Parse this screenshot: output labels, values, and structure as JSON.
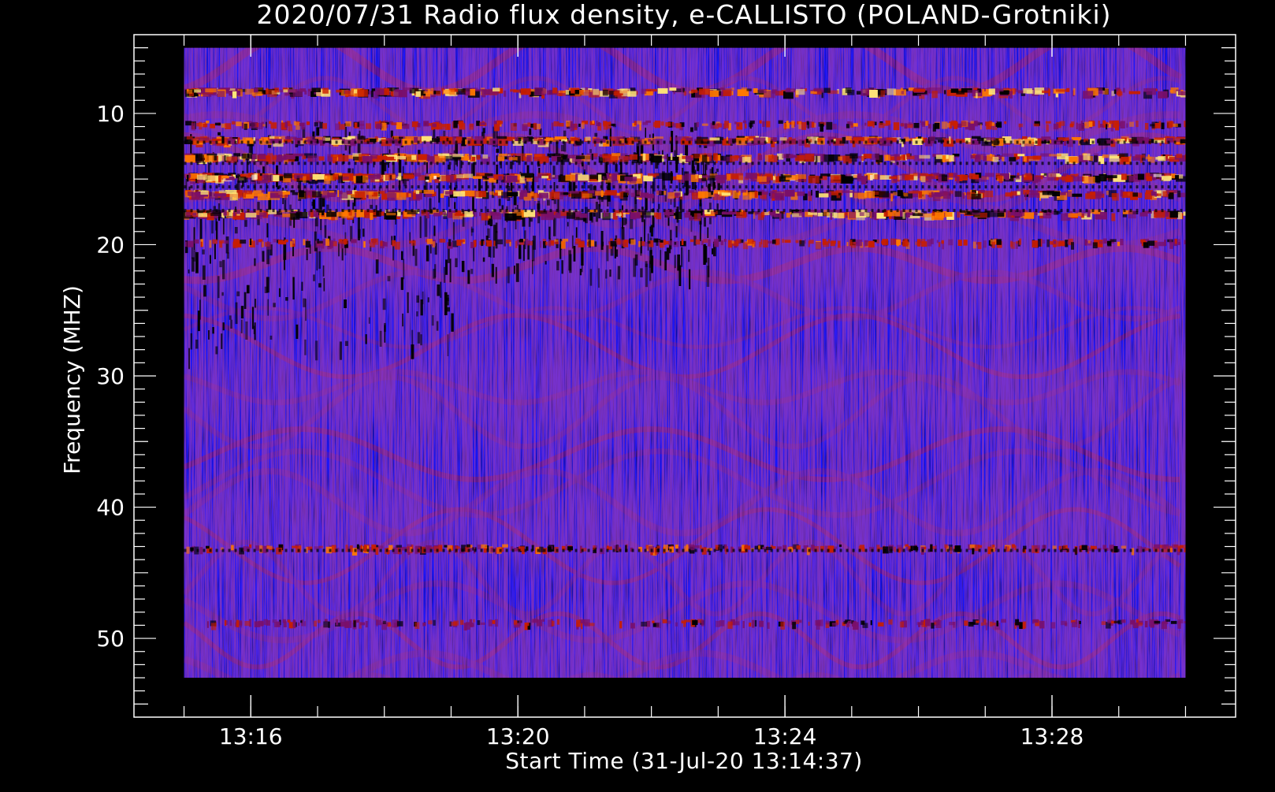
{
  "chart_data": {
    "type": "heatmap",
    "title": "2020/07/31  Radio flux density, e-CALLISTO (POLAND-Grotniki)",
    "xlabel": "Start Time (31-Jul-20 13:14:37)",
    "ylabel": "Frequency (MHZ)",
    "x_range": [
      "13:15:00",
      "13:30:00"
    ],
    "x_axis_range": [
      "13:14:15",
      "13:30:45"
    ],
    "x_ticks": [
      "13:16",
      "13:20",
      "13:24",
      "13:28"
    ],
    "y_range": [
      5,
      53
    ],
    "y_axis_range": [
      4,
      56
    ],
    "y_ticks": [
      10,
      20,
      30,
      40,
      50
    ],
    "y_inverted": true,
    "grid": false,
    "colormap": [
      "#000000",
      "#1414ff",
      "#2a1ee6",
      "#7a0f6a",
      "#c81e00",
      "#ff7800",
      "#ffe678",
      "#ffffff"
    ],
    "background_color": "#000000",
    "band_intensities": [
      {
        "freq_mhz": 8.5,
        "level": "high"
      },
      {
        "freq_mhz": 11.0,
        "level": "medium"
      },
      {
        "freq_mhz": 12.2,
        "level": "high"
      },
      {
        "freq_mhz": 13.5,
        "level": "high"
      },
      {
        "freq_mhz": 15.0,
        "level": "very high"
      },
      {
        "freq_mhz": 16.3,
        "level": "high"
      },
      {
        "freq_mhz": 17.8,
        "level": "high"
      },
      {
        "freq_mhz": 20.0,
        "level": "medium"
      },
      {
        "freq_mhz": 43.3,
        "level": "medium"
      },
      {
        "freq_mhz": 49.0,
        "level": "low"
      }
    ]
  }
}
